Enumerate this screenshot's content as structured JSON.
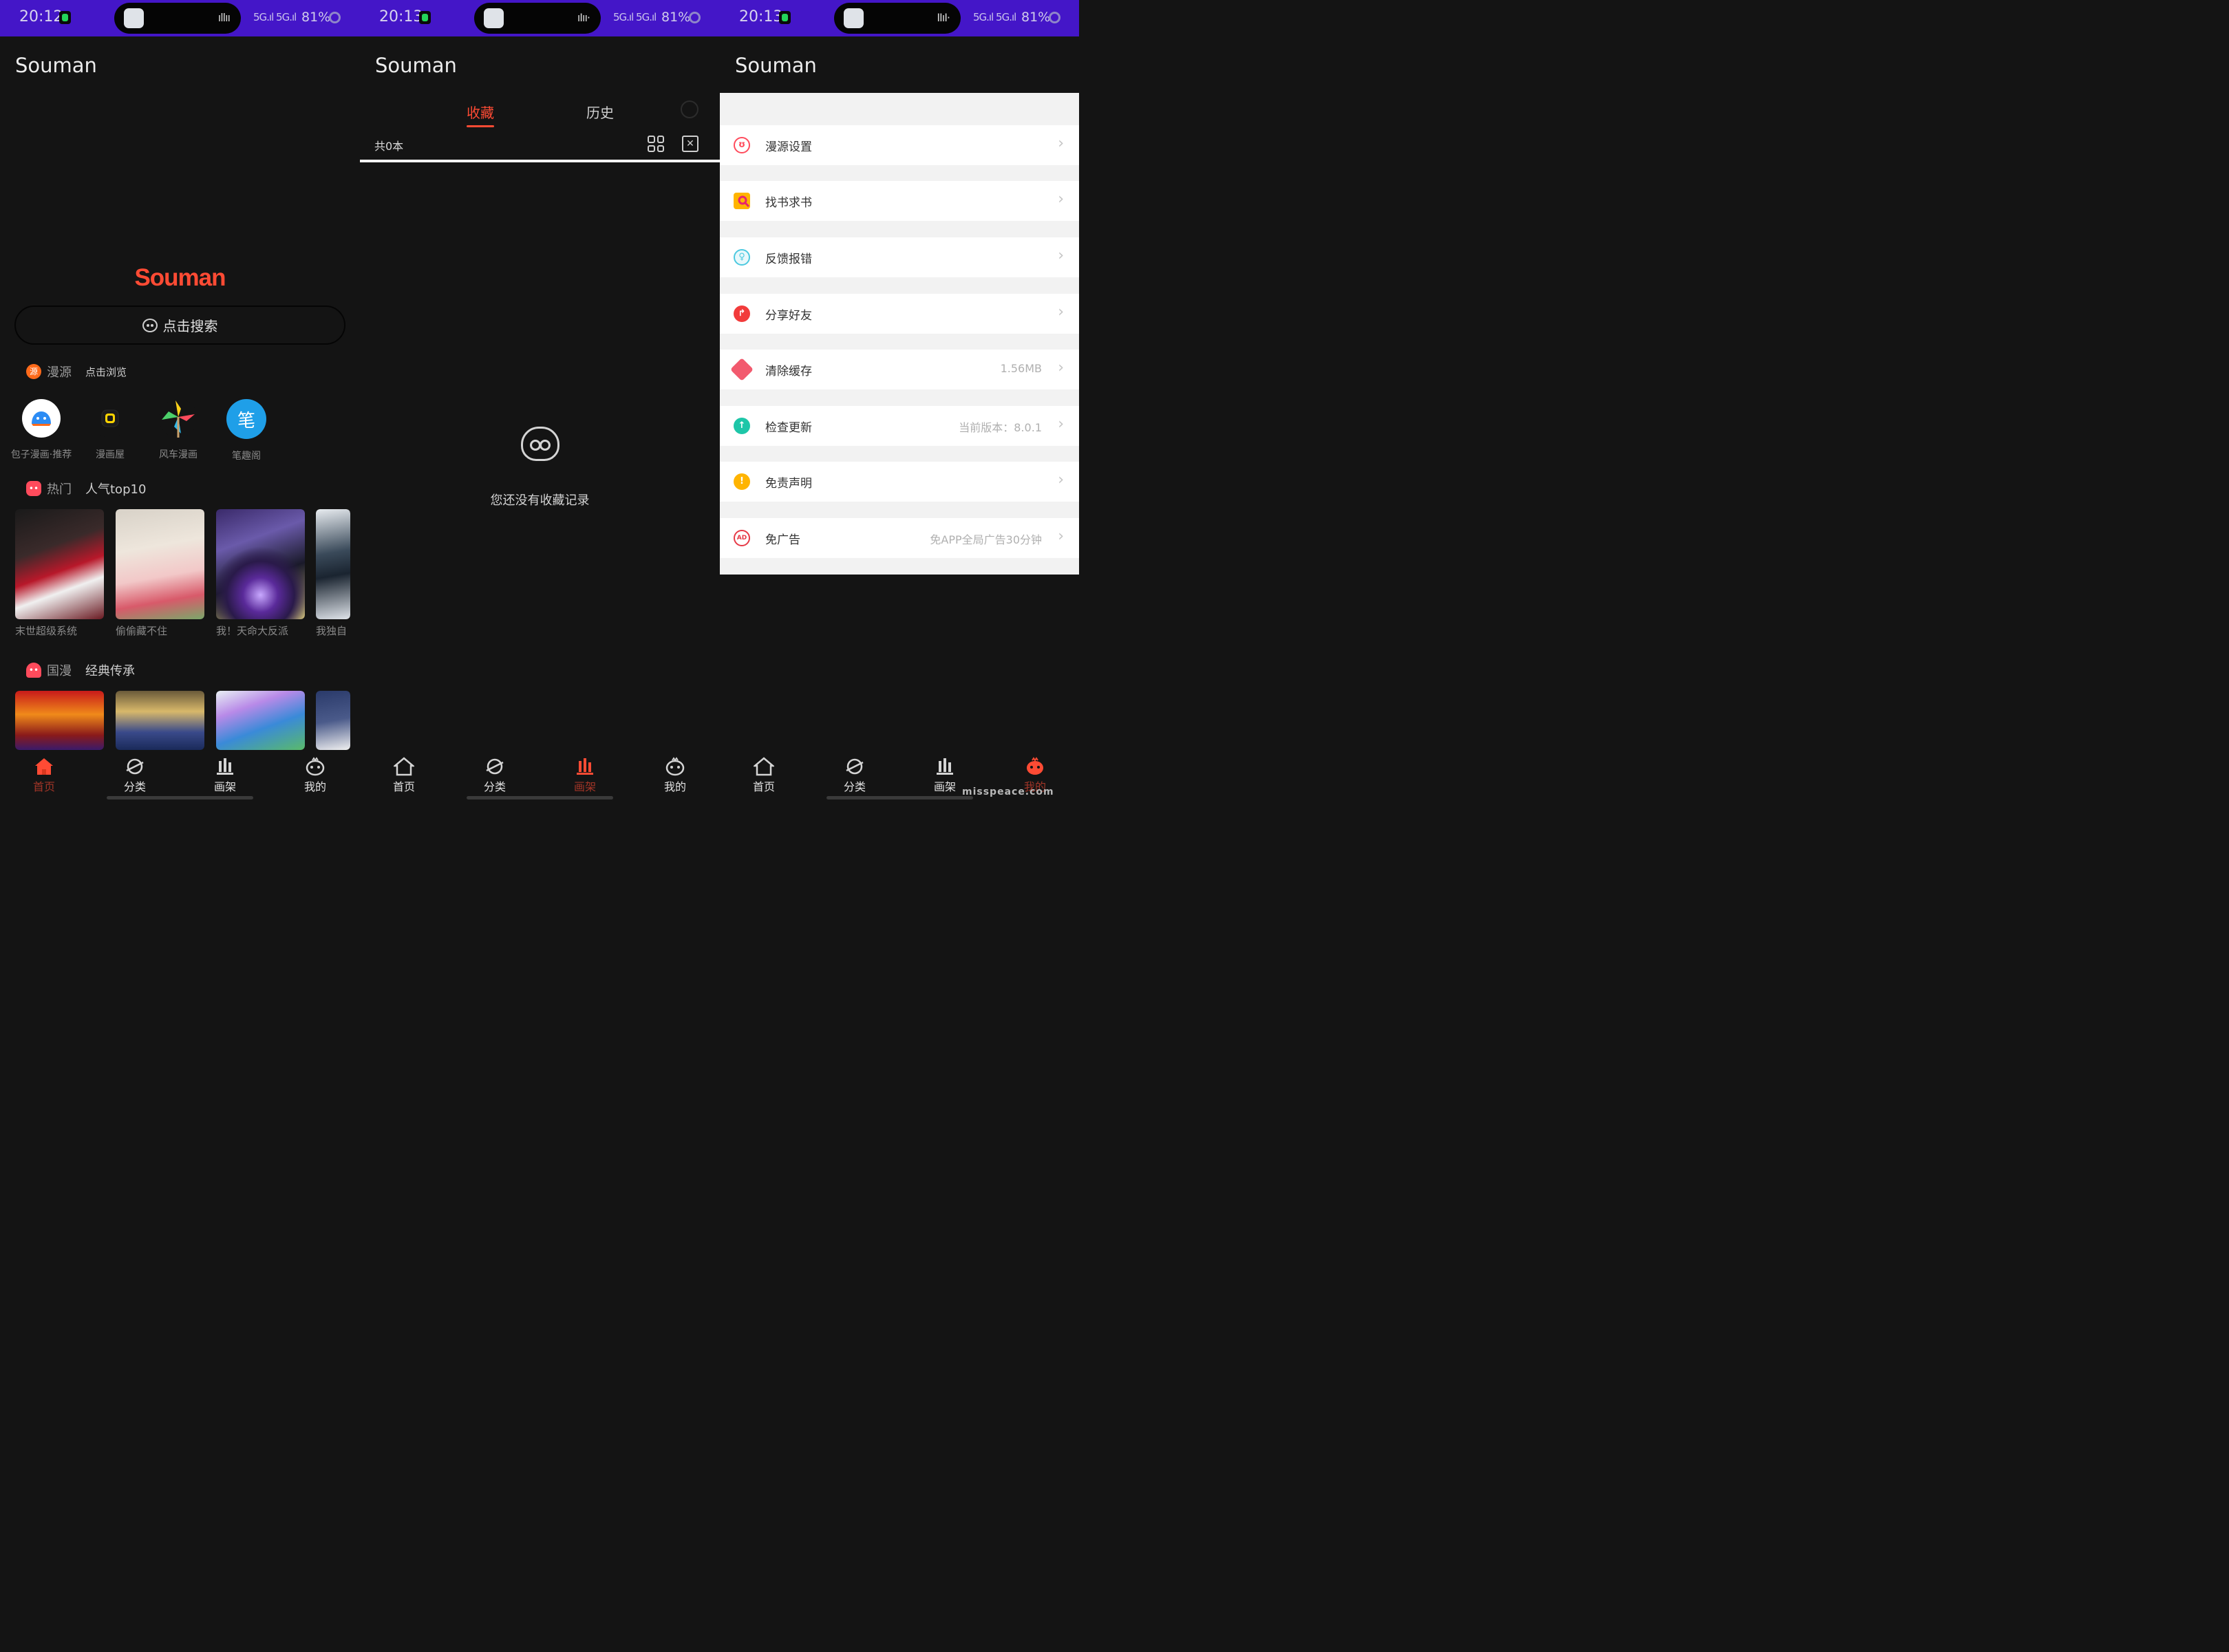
{
  "status": [
    {
      "time": "20:12",
      "signal": "5G.ıl 5G.ıl",
      "battery": "81%"
    },
    {
      "time": "20:13",
      "signal": "5G.ıl 5G.ıl",
      "battery": "81%"
    },
    {
      "time": "20:13",
      "signal": "5G.ıl 5G.ıl",
      "battery": "81%"
    }
  ],
  "app_title": "Souman",
  "home": {
    "logo": "Souman",
    "search_label": "点击搜索",
    "sources_section": {
      "badge": "源",
      "title": "漫源",
      "sub": "点击浏览"
    },
    "sources": [
      {
        "name": "包子漫画·推荐",
        "color": "#ffffff"
      },
      {
        "name": "漫画屋",
        "color": "#1a1a1a"
      },
      {
        "name": "风车漫画",
        "color": "#141414"
      },
      {
        "name": "笔趣阁",
        "color": "#1f9fe8"
      }
    ],
    "hot_section": {
      "title": "热门",
      "sub": "人气top10"
    },
    "hot_titles": [
      "末世超级系统",
      "偷偷藏不住",
      "我！天命大反派",
      "我独自"
    ],
    "guoman_section": {
      "title": "国漫",
      "sub": "经典传承"
    }
  },
  "shelf": {
    "tab_favorites": "收藏",
    "tab_history": "历史",
    "count_label": "共0本",
    "empty_text": "您还没有收藏记录"
  },
  "settings": [
    {
      "label": "漫源设置",
      "value": "",
      "icon": "bear-icon",
      "color": "#ff4b5c"
    },
    {
      "label": "找书求书",
      "value": "",
      "icon": "find-book-icon",
      "color": "#ffb400"
    },
    {
      "label": "反馈报错",
      "value": "",
      "icon": "lightbulb-icon",
      "color": "#4cc9e0"
    },
    {
      "label": "分享好友",
      "value": "",
      "icon": "share-icon",
      "color": "#f23b3b"
    },
    {
      "label": "清除缓存",
      "value": "1.56MB",
      "icon": "eraser-icon",
      "color": "#f25a6e"
    },
    {
      "label": "检查更新",
      "value": "当前版本：8.0.1",
      "icon": "upload-icon",
      "color": "#1ec6a8"
    },
    {
      "label": "免责声明",
      "value": "",
      "icon": "warning-icon",
      "color": "#ffb400"
    },
    {
      "label": "免广告",
      "value": "免APP全局广告30分钟",
      "icon": "no-ad-icon",
      "color": "#e63946"
    }
  ],
  "nav": {
    "home": "首页",
    "category": "分类",
    "shelf": "画架",
    "mine": "我的"
  },
  "accent": "#ff4b34",
  "watermark": "misspeace.com"
}
